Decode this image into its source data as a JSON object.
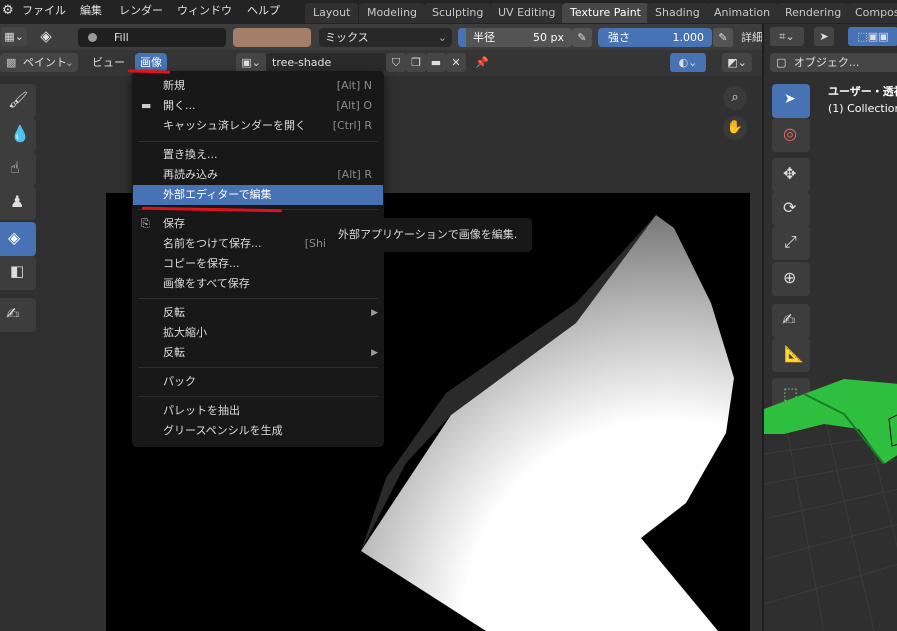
{
  "topmenu": {
    "file": "ファイル",
    "edit": "編集",
    "render": "レンダー",
    "window": "ウィンドウ",
    "help": "ヘルプ"
  },
  "workspaces": [
    "Layout",
    "Modeling",
    "Sculpting",
    "UV Editing",
    "Texture Paint",
    "Shading",
    "Animation",
    "Rendering",
    "Composi"
  ],
  "active_workspace": "Texture Paint",
  "toolsettings": {
    "brush_name": "Fill",
    "blend_mode": "ミックス",
    "radius_label": "半径",
    "radius_value": "50 px",
    "strength_label": "強さ",
    "strength_value": "1.000",
    "details": "詳細",
    "brush_color": "#a57e6a"
  },
  "header": {
    "mode": "ペイント",
    "view_menu": "ビュー",
    "image_menu": "画像",
    "image_name": "tree-shade"
  },
  "image_menu": {
    "items": [
      {
        "label": "新規",
        "shortcut": "[Alt] N"
      },
      {
        "label": "開く...",
        "shortcut": "[Alt] O"
      },
      {
        "label": "キャッシュ済レンダーを開く",
        "shortcut": "[Ctrl] R"
      },
      {
        "label": "置き換え..."
      },
      {
        "label": "再読み込み",
        "shortcut": "[Alt] R"
      },
      {
        "label": "外部エディターで編集"
      },
      {
        "label": "保存"
      },
      {
        "label": "名前をつけて保存...",
        "shortcut": "[Shi"
      },
      {
        "label": "コピーを保存..."
      },
      {
        "label": "画像をすべて保存"
      },
      {
        "label": "反転"
      },
      {
        "label": "拡大縮小"
      },
      {
        "label": "反転"
      },
      {
        "label": "パック"
      },
      {
        "label": "パレットを抽出"
      },
      {
        "label": "グリースペンシルを生成"
      }
    ],
    "highlighted": "外部エディターで編集"
  },
  "tooltip": "外部アプリケーションで画像を編集.",
  "right_header": {
    "object_mode": "オブジェク...",
    "view_title": "ユーザー・透視",
    "collection": "(1) Collection"
  },
  "colors": {
    "accent": "#4772b3",
    "annotation_red": "#e0121f",
    "menu_bg": "#181818",
    "gizmo_green": "#2fbf3f"
  }
}
